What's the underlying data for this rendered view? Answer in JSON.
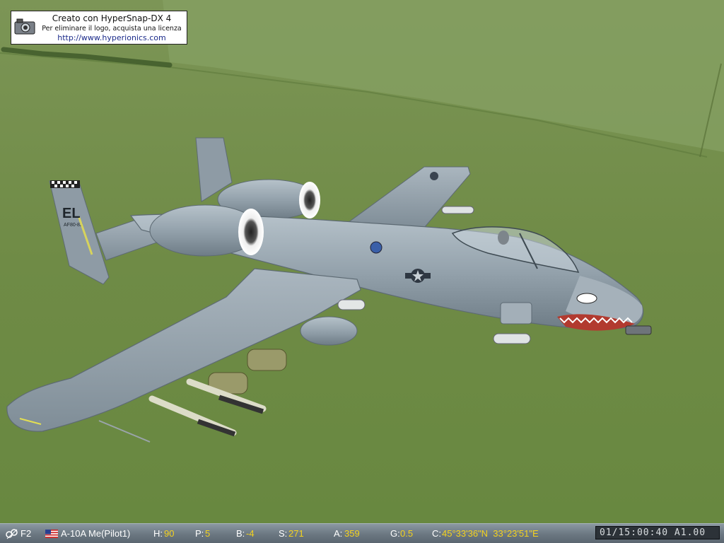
{
  "watermark": {
    "line1": "Creato con HyperSnap-DX 4",
    "line2": "Per eliminare il logo, acquista una licenza",
    "line3": "http://www.hyperionics.com"
  },
  "aircraft": {
    "tail_code": "EL",
    "serial": "AF80-82"
  },
  "hud": {
    "camera_key": "F2",
    "flag_icon": "us-flag-icon",
    "unit": "A-10A Me(Pilot1)",
    "heading_label": "H:",
    "heading": "90",
    "pitch_label": "P:",
    "pitch": "5",
    "bank_label": "B:",
    "bank": "-4",
    "speed_label": "S:",
    "speed": "271",
    "altitude_label": "A:",
    "altitude": "359",
    "g_label": "G:",
    "g": "0.5",
    "coord_label": "C:",
    "coords": "45°33'36\"N  33°23'51\"E",
    "clock": "01/15:00:40 A1.00"
  },
  "colors": {
    "hud_value": "#f4d21e",
    "grass": "#6f8a45",
    "airframe": "#9aa7b1"
  }
}
